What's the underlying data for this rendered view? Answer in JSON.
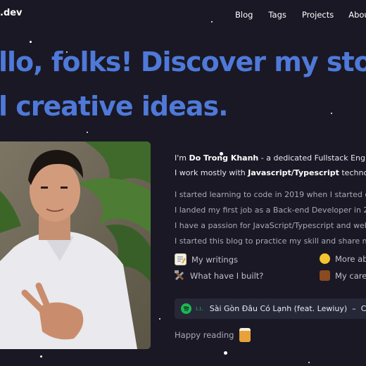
{
  "header": {
    "brand": ".dev",
    "nav": [
      "Blog",
      "Tags",
      "Projects",
      "About"
    ]
  },
  "hero": {
    "line1": "llo, folks! Discover my sto",
    "line2": "l creative ideas."
  },
  "intro": {
    "line1_prefix": "I'm ",
    "name": "Do Trong Khanh",
    "line1_suffix": " - a dedicated Fullstack Engine",
    "line2_prefix": "I work mostly with ",
    "tech": "Javascript/Typescript",
    "line2_suffix": " technolog"
  },
  "paragraphs": [
    "I started learning to code in 2019 when I started co",
    "I landed my first job as a Back-end Developer in 20",
    "I have a passion for JavaScript/Typescript and web",
    "I started this blog to practice my skill and share my"
  ],
  "links": {
    "writings": "My writings",
    "about": "More ab",
    "built": "What have I built?",
    "career": "My care"
  },
  "player": {
    "bars": "ı.ı.",
    "track": "Sài Gòn Đâu Có Lạnh (feat. Lewiuy)",
    "sep": "–",
    "artist": "Ch"
  },
  "footer_note": "Happy reading",
  "colors": {
    "background": "#191824",
    "accent": "#4f79d9",
    "spotify": "#1db954"
  },
  "icons": [
    "memo-icon",
    "thinking-face-icon",
    "hammer-wrench-icon",
    "briefcase-icon",
    "spotify-icon",
    "beer-mugs-icon"
  ]
}
